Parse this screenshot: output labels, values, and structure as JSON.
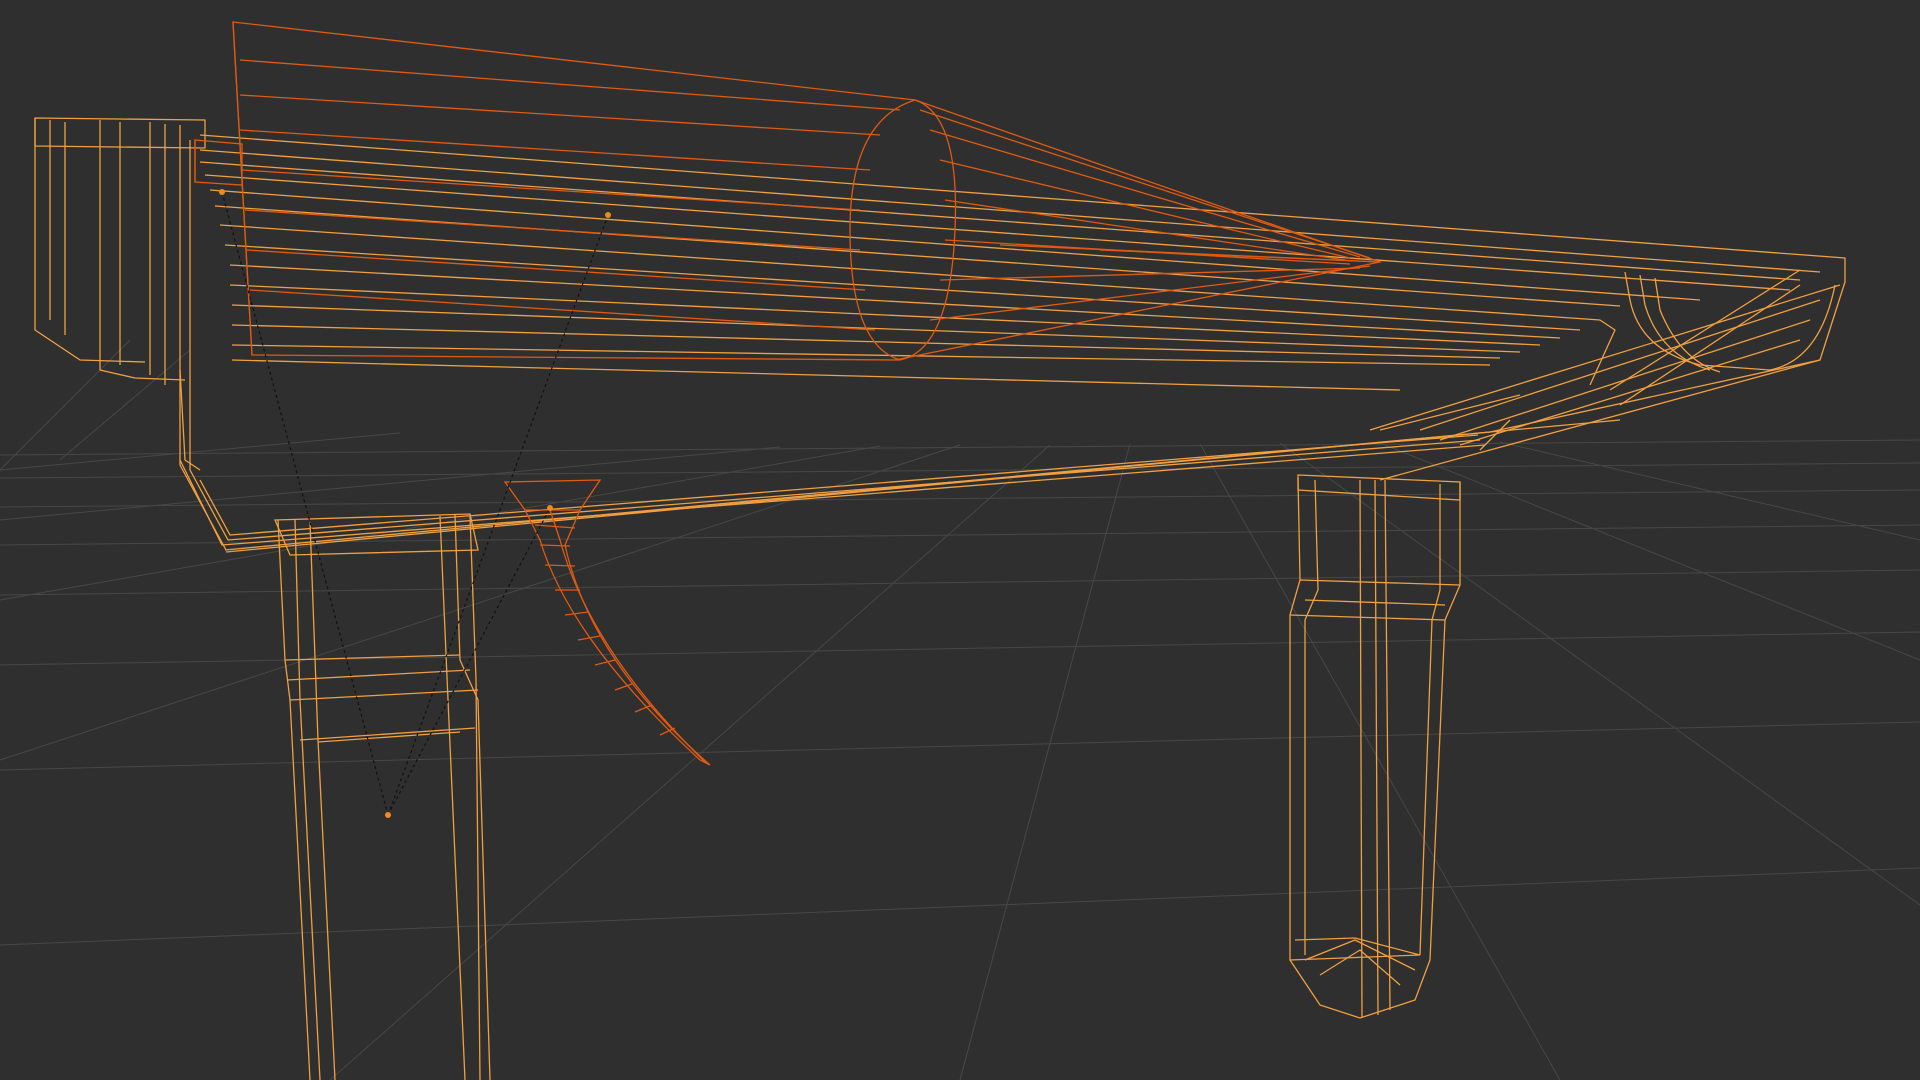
{
  "viewport": {
    "background": "#2f2f2f",
    "grid_color": "#474747",
    "wire_selected_color": "#f0a040",
    "wire_active_color": "#e05a10",
    "vertex_dot_color": "#f08a20",
    "parent_line_color": "#111111"
  },
  "objects": [
    {
      "name": "table-top",
      "state": "selected"
    },
    {
      "name": "left-leg",
      "state": "selected"
    },
    {
      "name": "right-leg",
      "state": "selected"
    },
    {
      "name": "barrel-shroud",
      "state": "active"
    },
    {
      "name": "trigger",
      "state": "active"
    }
  ]
}
